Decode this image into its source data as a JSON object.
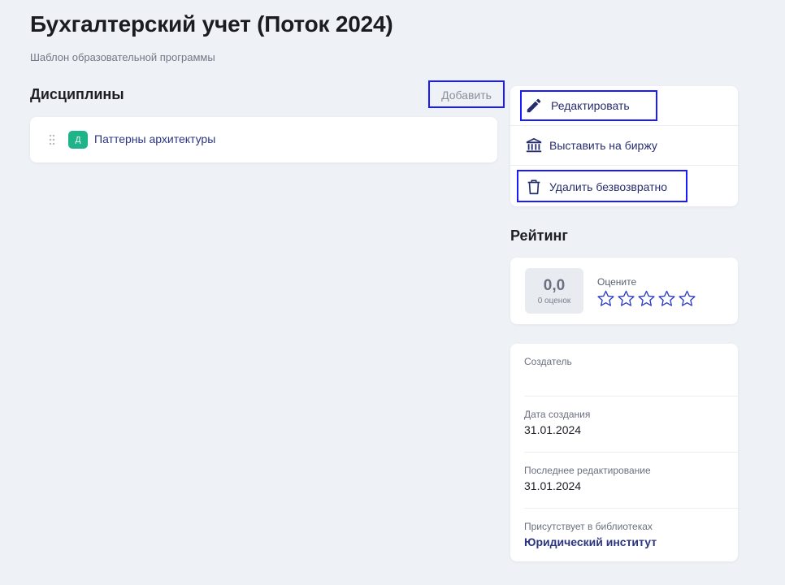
{
  "page": {
    "title": "Бухгалтерский учет (Поток 2024)",
    "subtitle": "Шаблон образовательной программы"
  },
  "disciplines": {
    "heading": "Дисциплины",
    "add_label": "Добавить",
    "items": [
      {
        "badge": "Д",
        "name": "Паттерны архитектуры"
      }
    ]
  },
  "actions": {
    "edit_label": "Редактировать",
    "exchange_label": "Выставить на биржу",
    "delete_label": "Удалить безвозвратно"
  },
  "rating": {
    "heading": "Рейтинг",
    "score": "0,0",
    "count": "0 оценок",
    "rate_label": "Оцените",
    "stars_total": 5,
    "stars_filled": 0
  },
  "info": {
    "creator_label": "Создатель",
    "creator_value": "",
    "created_label": "Дата создания",
    "created_value": "31.01.2024",
    "edited_label": "Последнее редактирование",
    "edited_value": "31.01.2024",
    "libraries_label": "Присутствует в библиотеках",
    "libraries_value": "Юридический институт"
  },
  "colors": {
    "background": "#eef1f5",
    "accent_text": "#2b3580",
    "badge_green": "#1fb38a",
    "highlight_box": "#1a1aff",
    "star_outline": "#2b3cc4"
  },
  "icons": {
    "edit": "pencil-icon",
    "exchange": "bank-icon",
    "delete": "trash-icon",
    "drag": "drag-handle-icon",
    "star": "star-outline-icon"
  }
}
